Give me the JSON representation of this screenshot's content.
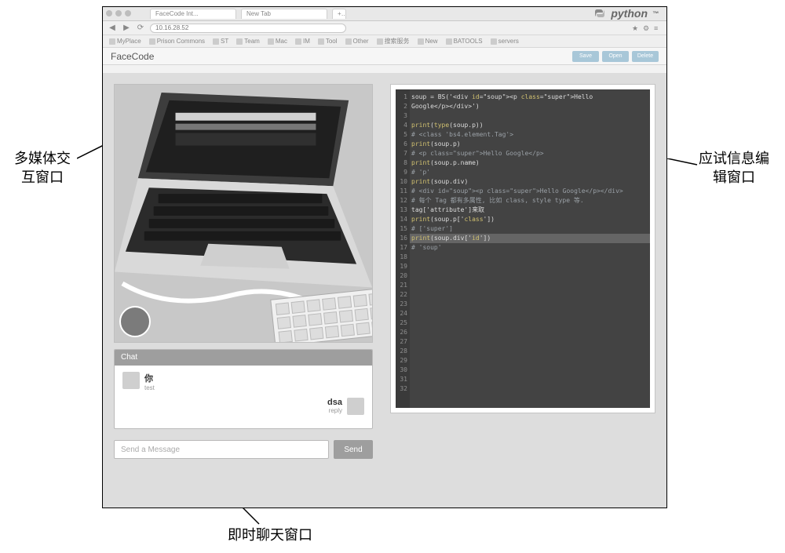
{
  "labels": {
    "multimedia": "多媒体交\n互窗口",
    "chat": "即时聊天窗口",
    "editor": "应试信息编\n辑窗口"
  },
  "browser": {
    "tabs": [
      "FaceCode Int...",
      "New Tab"
    ],
    "url": "10.16.28.52",
    "brand": "python",
    "bookmarks": [
      "MyPlace",
      "Prison Commons",
      "ST",
      "Team",
      "Mac",
      "IM",
      "Tool",
      "Other",
      "搜索服务",
      "New",
      "BATOOLS",
      "servers"
    ],
    "topicons": [
      "★",
      "⚙",
      "≡"
    ]
  },
  "app": {
    "title": "FaceCode",
    "buttons": [
      "Save",
      "Open",
      "Delete"
    ]
  },
  "chat": {
    "header": "Chat",
    "messages": [
      {
        "side": "left",
        "name": "你",
        "meta": "test"
      },
      {
        "side": "right",
        "name": "dsa",
        "meta": "reply"
      }
    ],
    "placeholder": "Send a Message",
    "send": "Send"
  },
  "code": {
    "highlight_line": 15,
    "lines": [
      "soup = BS('<div id=\"soup\"><p class=\"super\">Hello",
      "Google</p></div>')",
      "",
      "print(type(soup.p))",
      "# <class 'bs4.element.Tag'>",
      "print(soup.p)",
      "# <p class=\"super\">Hello Google</p>",
      "print(soup.p.name)",
      "# 'p'",
      "print(soup.div)",
      "# <div id=\"soup\"><p class=\"super\">Hello Google</p></div>",
      "# 每个 Tag 都有多属性, 比如 class, style type 等.",
      "tag['attribute']来取",
      "print(soup.p['class'])",
      "# ['super']",
      "print(soup.div['id'])",
      "# 'soup'"
    ]
  }
}
